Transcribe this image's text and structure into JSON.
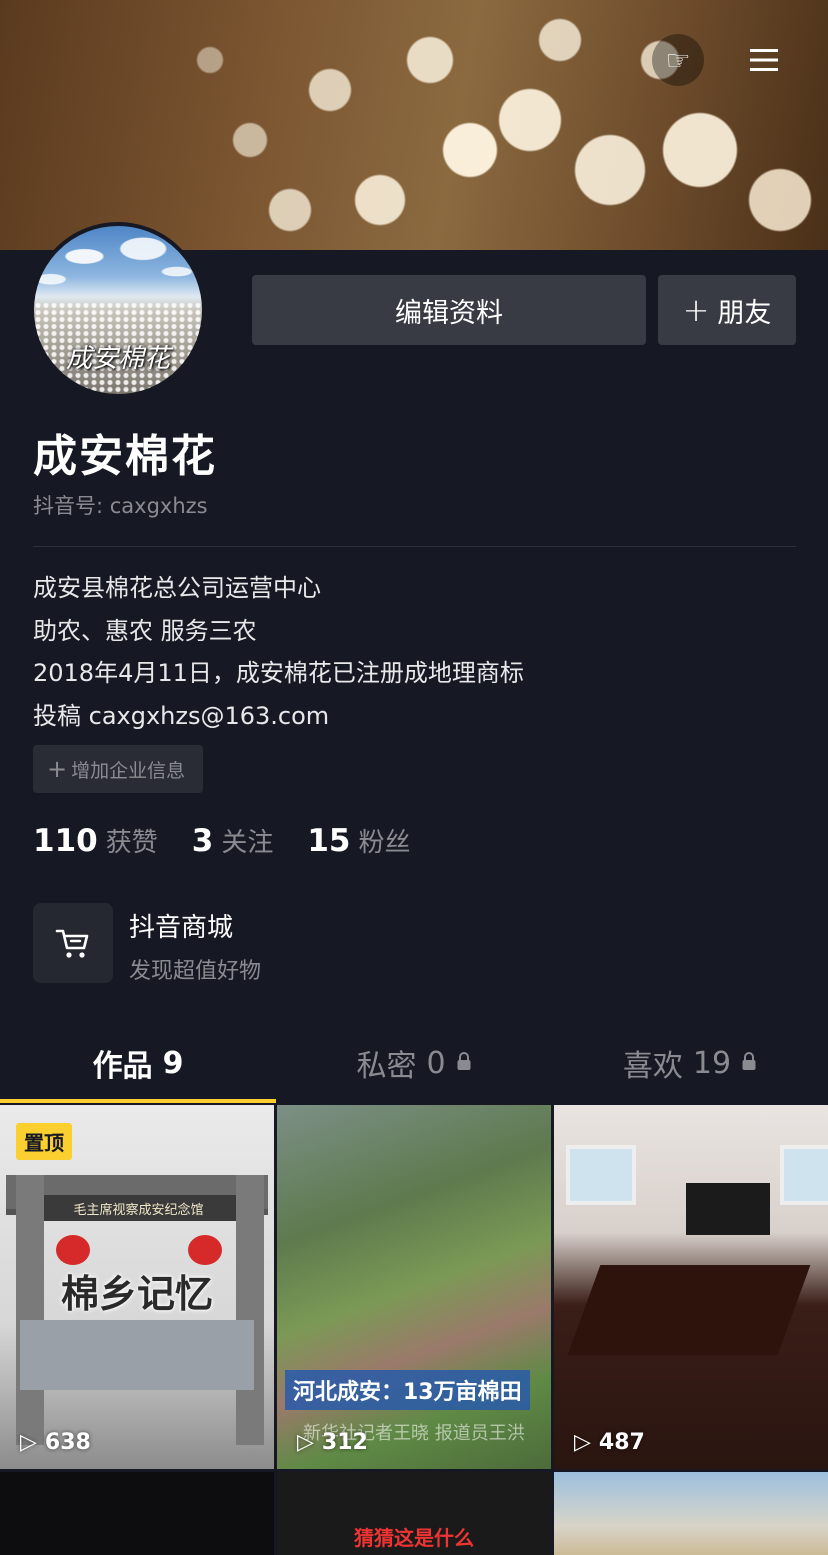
{
  "profile": {
    "avatar_text": "成安棉花",
    "name": "成安棉花",
    "douyin_id": "抖音号: caxgxhzs",
    "bio": [
      "成安县棉花总公司运营中心",
      "助农、惠农 服务三农",
      "2018年4月11日，成安棉花已注册成地理商标",
      "投稿 caxgxhzs@163.com"
    ]
  },
  "buttons": {
    "edit_profile": "编辑资料",
    "add_friend": "朋友",
    "add_company_info": "增加企业信息"
  },
  "stats": [
    {
      "num": "110",
      "label": "获赞"
    },
    {
      "num": "3",
      "label": "关注"
    },
    {
      "num": "15",
      "label": "粉丝"
    }
  ],
  "shop": {
    "title": "抖音商城",
    "subtitle": "发现超值好物"
  },
  "tabs": [
    {
      "label": "作品",
      "count": "9"
    },
    {
      "label": "私密",
      "count": "0"
    },
    {
      "label": "喜欢",
      "count": "19"
    }
  ],
  "videos": [
    {
      "pinned_label": "置顶",
      "sign_text": "毛主席视察成安纪念馆",
      "title": "棉乡记忆",
      "views": "638"
    },
    {
      "caption": "河北成安：13万亩棉田",
      "sub": "新华社记者王晓 报道员王洪",
      "views": "312"
    },
    {
      "views": "487"
    },
    {},
    {
      "title": "猜猜这是什么"
    },
    {}
  ],
  "colors": {
    "background": "#161823",
    "accent": "#fbcf30",
    "button_bg": "#393b44",
    "muted_text": "#8a8b91"
  },
  "icons": [
    "hand-pointing-icon",
    "menu-icon",
    "plus-icon",
    "cart-icon",
    "lock-icon",
    "play-icon"
  ]
}
